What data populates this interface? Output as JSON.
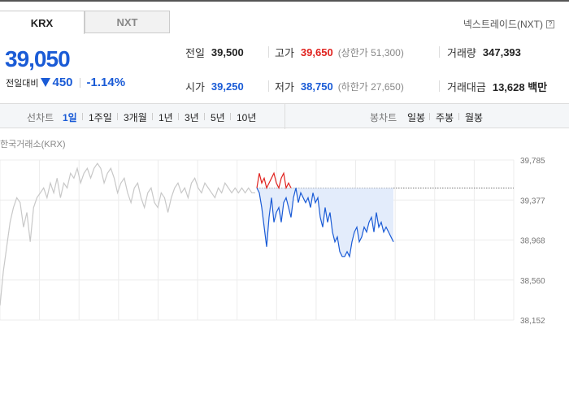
{
  "tabs": [
    {
      "label": "KRX",
      "active": true
    },
    {
      "label": "NXT",
      "active": false
    }
  ],
  "nxt_link": {
    "label": "넥스트레이드(NXT)",
    "help_icon": "question-box-icon"
  },
  "price": {
    "current": "39,050",
    "change_label": "전일대비",
    "change_amount": "450",
    "change_pct": "-1.14%",
    "direction_icon": "down-triangle-icon"
  },
  "stats": {
    "prev": {
      "label": "전일",
      "value": "39,500"
    },
    "high": {
      "label": "고가",
      "value": "39,650",
      "sub": "(상한가 51,300)"
    },
    "volume": {
      "label": "거래량",
      "value": "347,393"
    },
    "open": {
      "label": "시가",
      "value": "39,250"
    },
    "low": {
      "label": "저가",
      "value": "38,750",
      "sub": "(하한가 27,650)"
    },
    "amount": {
      "label": "거래대금",
      "value": "13,628 백만"
    }
  },
  "period_bar": {
    "line_label": "선차트",
    "line_options": [
      "1일",
      "1주일",
      "3개월",
      "1년",
      "3년",
      "5년",
      "10년"
    ],
    "active": "1일",
    "candle_label": "봉차트",
    "candle_options": [
      "일봉",
      "주봉",
      "월봉"
    ]
  },
  "colors": {
    "up": "#e0221e",
    "down": "#1a5bd6",
    "prev_day": "#c8c8c8",
    "area": "#e3ecfb"
  },
  "chart_data": {
    "type": "line",
    "title": "한국거래소(KRX)",
    "y_ticks": [
      "39,785",
      "39,377",
      "38,968",
      "38,560",
      "38,152"
    ],
    "ylim": [
      38152,
      39785
    ],
    "reference_value": 39500,
    "grid": true,
    "series": [
      {
        "values": [
          38300,
          38650,
          38900,
          39150,
          39300,
          39400,
          39350,
          39100,
          39250,
          38950,
          39300,
          39400,
          39450,
          39500,
          39400,
          39550,
          39450,
          39600,
          39400,
          39550,
          39500,
          39650,
          39600,
          39700,
          39550,
          39650,
          39700,
          39600,
          39700,
          39750,
          39700,
          39550,
          39650,
          39700,
          39600,
          39450,
          39550,
          39600,
          39450,
          39350,
          39500,
          39550,
          39400,
          39300,
          39450,
          39500,
          39350,
          39300,
          39450,
          39400,
          39250,
          39400,
          39500,
          39550,
          39450,
          39500,
          39400,
          39550,
          39600,
          39500,
          39450,
          39550,
          39500,
          39450,
          39400,
          39500,
          39450,
          39550,
          39500,
          39450,
          39500,
          39450,
          39500,
          39450,
          39500,
          39450,
          39450
        ]
      },
      {
        "values": [
          39500,
          39650,
          39550,
          39600,
          39500,
          39550,
          39600,
          39650,
          39550,
          39500,
          39600,
          39650,
          39500,
          39550,
          39500
        ]
      },
      {
        "values": [
          39500,
          39450,
          39300,
          39100,
          38900,
          39200,
          39400,
          39150,
          39250,
          39300,
          39150,
          39350,
          39400,
          39300,
          39200,
          39400,
          39500,
          39350,
          39450,
          39400,
          39350,
          39400,
          39300,
          39450,
          39350,
          39400,
          39200,
          39100,
          39300,
          39150,
          39250,
          39050,
          38950,
          39000,
          38850,
          38800,
          38800,
          38850,
          38800,
          38950,
          39050,
          39100,
          38950,
          39000,
          39100,
          39050,
          39150,
          39200,
          39050,
          39250,
          39100,
          39150,
          39050,
          39100,
          39050,
          39000,
          38950
        ]
      }
    ]
  }
}
